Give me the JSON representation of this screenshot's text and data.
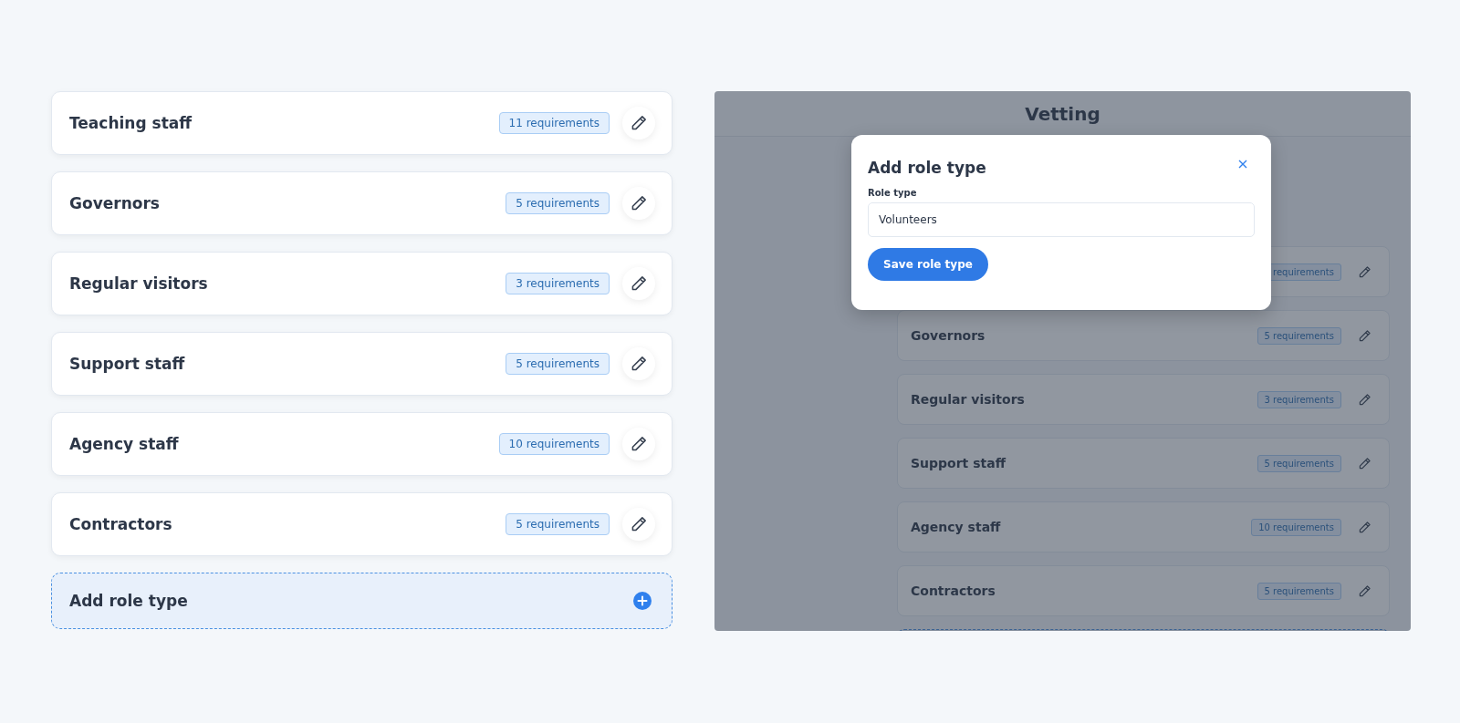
{
  "role_list": {
    "roles": [
      {
        "title": "Teaching staff",
        "badge": "11 requirements"
      },
      {
        "title": "Governors",
        "badge": "5 requirements"
      },
      {
        "title": "Regular visitors",
        "badge": "3 requirements"
      },
      {
        "title": "Support staff",
        "badge": "5 requirements"
      },
      {
        "title": "Agency staff",
        "badge": "10 requirements"
      },
      {
        "title": "Contractors",
        "badge": "5 requirements"
      }
    ],
    "add_button": {
      "label": "Add role type"
    }
  },
  "preview": {
    "header": {
      "title": "Vetting"
    },
    "roles": [
      {
        "badge": "requirements"
      },
      {
        "title": "Governors",
        "badge": "5 requirements"
      },
      {
        "title": "Regular visitors",
        "badge": "3 requirements"
      },
      {
        "title": "Support staff",
        "badge": "5 requirements"
      },
      {
        "title": "Agency staff",
        "badge": "10 requirements"
      },
      {
        "title": "Contractors",
        "badge": "5 requirements"
      }
    ],
    "modal": {
      "title": "Add role type",
      "field": {
        "label": "Role type",
        "value": "Volunteers"
      },
      "save_button": "Save role type"
    }
  }
}
